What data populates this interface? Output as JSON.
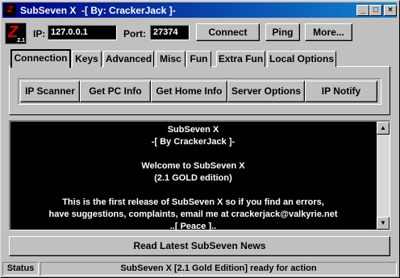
{
  "window": {
    "title": "SubSeven X  -[ By: CrackerJack ]-",
    "minimize": "_",
    "maximize": "□",
    "close": "×"
  },
  "logo": {
    "mark": "Z",
    "version": "2.1"
  },
  "connection": {
    "ip_label": "IP:",
    "ip_value": "127.0.0.1",
    "port_label": "Port:",
    "port_value": "27374",
    "connect_label": "Connect",
    "ping_label": "Ping",
    "more_label": "More..."
  },
  "tabs": [
    {
      "label": "Connection",
      "active": true
    },
    {
      "label": "Keys"
    },
    {
      "label": "Advanced"
    },
    {
      "label": "Misc"
    },
    {
      "label": "Fun"
    },
    {
      "label": "Extra Fun"
    },
    {
      "label": "Local Options"
    }
  ],
  "subbuttons": [
    "IP Scanner",
    "Get PC Info",
    "Get Home Info",
    "Server Options",
    "IP Notify"
  ],
  "message": "SubSeven X\n-[ By CrackerJack ]-\n\nWelcome to SubSeven X\n(2.1 GOLD edition)\n\nThis is the first release of SubSeven X so if you find an errors,\nhave suggestions, complaints, email me at crackerjack@valkyrie.net\n..[ Peace ]..",
  "news_label": "Read Latest SubSeven News",
  "status": {
    "label": "Status",
    "text": "SubSeven X [2.1 Gold Edition] ready for action"
  },
  "colors": {
    "title_start": "#000080",
    "title_end": "#1084d0",
    "face": "#c0c0c0",
    "console_bg": "#000000"
  }
}
